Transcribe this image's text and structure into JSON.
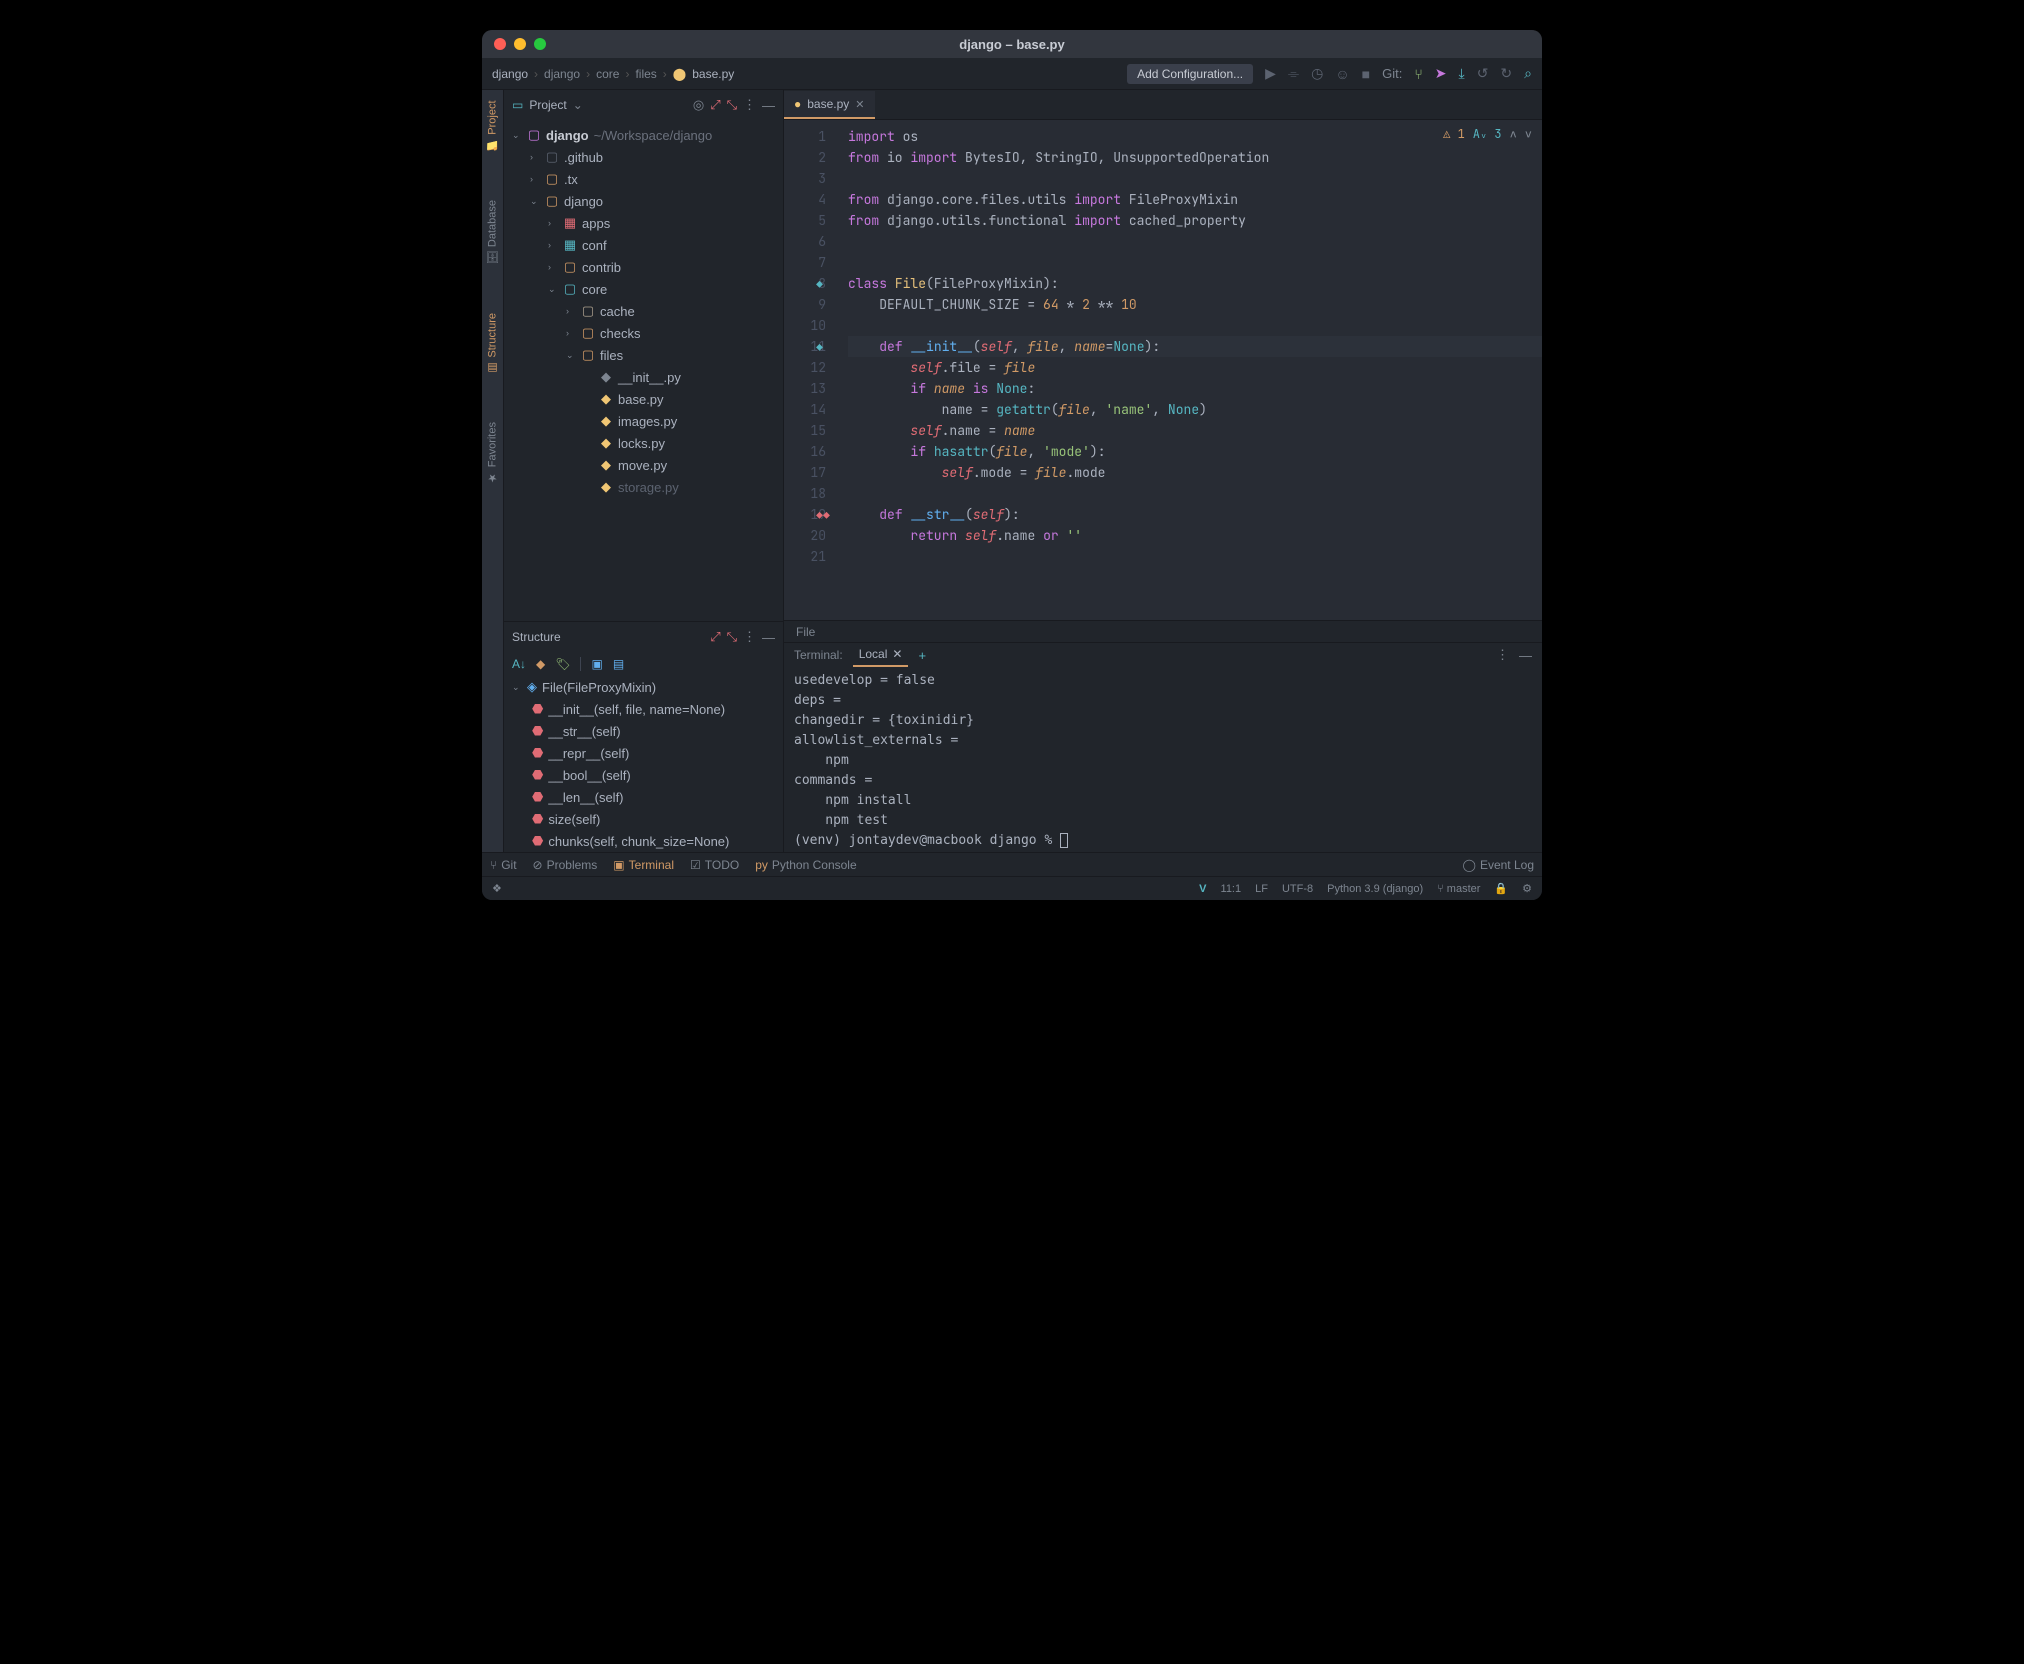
{
  "title": "django – base.py",
  "breadcrumb": [
    "django",
    "django",
    "core",
    "files",
    "base.py"
  ],
  "add_conf": "Add Configuration...",
  "git_label": "Git:",
  "project_label": "Project",
  "left_rails": [
    "Project",
    "Database",
    "Structure",
    "Favorites"
  ],
  "tree": {
    "root": {
      "name": "django",
      "path": "~/Workspace/django"
    },
    "items": [
      {
        "d": 1,
        "exp": "›",
        "icon": "dir",
        "name": ".github"
      },
      {
        "d": 1,
        "exp": "›",
        "icon": "fold",
        "name": ".tx"
      },
      {
        "d": 1,
        "exp": "⌄",
        "icon": "fold",
        "name": "django"
      },
      {
        "d": 2,
        "exp": "›",
        "icon": "mod",
        "name": "apps"
      },
      {
        "d": 2,
        "exp": "›",
        "icon": "mod",
        "name": "conf",
        "iconColor": "#56b6c2"
      },
      {
        "d": 2,
        "exp": "›",
        "icon": "fold",
        "name": "contrib"
      },
      {
        "d": 2,
        "exp": "⌄",
        "icon": "fold",
        "name": "core",
        "iconColor": "#56b6c2"
      },
      {
        "d": 3,
        "exp": "›",
        "icon": "fold",
        "name": "cache",
        "iconColor": "#ab9f8d"
      },
      {
        "d": 3,
        "exp": "›",
        "icon": "fold",
        "name": "checks"
      },
      {
        "d": 3,
        "exp": "⌄",
        "icon": "fold",
        "name": "files"
      },
      {
        "d": 4,
        "exp": "",
        "icon": "py",
        "name": "__init__.py",
        "iconColor": "#7d8590"
      },
      {
        "d": 4,
        "exp": "",
        "icon": "py",
        "name": "base.py"
      },
      {
        "d": 4,
        "exp": "",
        "icon": "py",
        "name": "images.py"
      },
      {
        "d": 4,
        "exp": "",
        "icon": "py",
        "name": "locks.py"
      },
      {
        "d": 4,
        "exp": "",
        "icon": "py",
        "name": "move.py"
      },
      {
        "d": 4,
        "exp": "",
        "icon": "py",
        "name": "storage.py",
        "dim": true
      }
    ]
  },
  "structure_label": "Structure",
  "structure": [
    "File(FileProxyMixin)",
    "__init__(self, file, name=None)",
    "__str__(self)",
    "__repr__(self)",
    "__bool__(self)",
    "__len__(self)",
    "size(self)",
    "chunks(self, chunk_size=None)"
  ],
  "tab": {
    "name": "base.py"
  },
  "inspections": {
    "warn": "1",
    "info": "3"
  },
  "code_lines": 21,
  "editor_crumb": "File",
  "terminal": {
    "label": "Terminal:",
    "tab": "Local",
    "lines": [
      "usedevelop = false",
      "deps =",
      "changedir = {toxinidir}",
      "allowlist_externals =",
      "    npm",
      "commands =",
      "    npm install",
      "    npm test"
    ],
    "prompt": "(venv) jontaydev@macbook django % "
  },
  "bottom_tools": [
    "Git",
    "Problems",
    "Terminal",
    "TODO",
    "Python Console"
  ],
  "event_log": "Event Log",
  "status": {
    "pos": "11:1",
    "le": "LF",
    "enc": "UTF-8",
    "sdk": "Python 3.9 (django)",
    "branch": "master"
  }
}
